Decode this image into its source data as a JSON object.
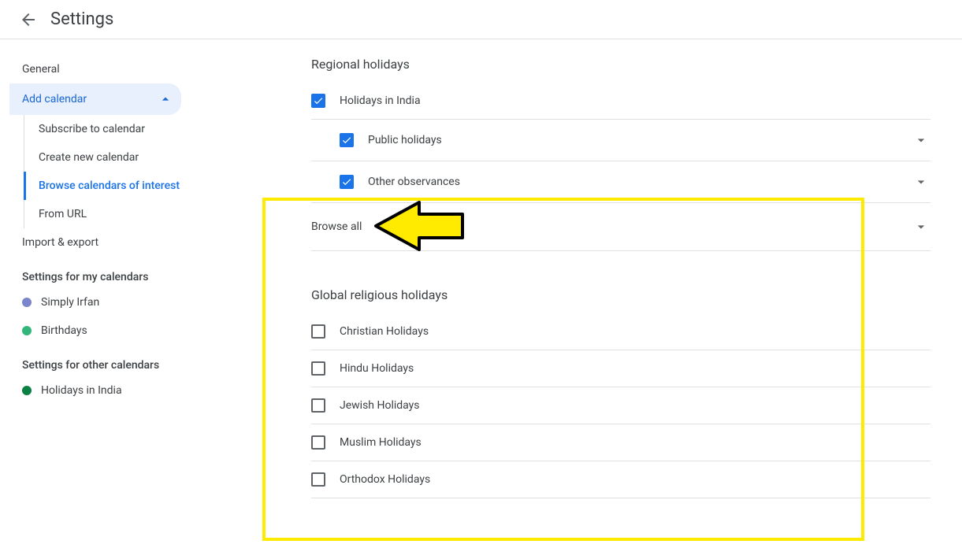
{
  "header": {
    "title": "Settings"
  },
  "sidebar": {
    "general": "General",
    "add_calendar": "Add calendar",
    "subscribe": "Subscribe to calendar",
    "create_new": "Create new calendar",
    "browse": "Browse calendars of interest",
    "from_url": "From URL",
    "import_export": "Import & export",
    "settings_my": "Settings for my calendars",
    "cal1": {
      "label": "Simply Irfan",
      "color": "#7986cb"
    },
    "cal2": {
      "label": "Birthdays",
      "color": "#33b679"
    },
    "settings_other": "Settings for other calendars",
    "cal3": {
      "label": "Holidays in India",
      "color": "#0b8043"
    }
  },
  "content": {
    "regional_title": "Regional holidays",
    "holidays_india": "Holidays in India",
    "public_holidays": "Public holidays",
    "other_observances": "Other observances",
    "browse_all": "Browse all",
    "global_title": "Global religious holidays",
    "christian": "Christian Holidays",
    "hindu": "Hindu Holidays",
    "jewish": "Jewish Holidays",
    "muslim": "Muslim Holidays",
    "orthodox": "Orthodox Holidays"
  }
}
